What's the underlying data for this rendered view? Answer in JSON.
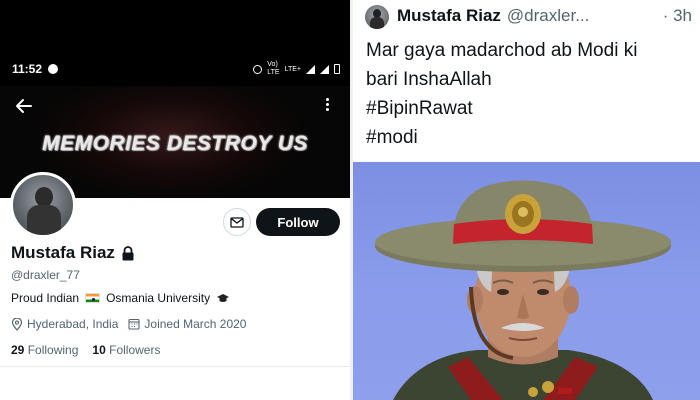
{
  "status_bar": {
    "time": "11:52",
    "network": "Vo) LTE",
    "network_lines": [
      "Vo)",
      "LTE"
    ],
    "lte": "LTE+"
  },
  "profile": {
    "banner_text": "MEMORIES DESTROY US",
    "name": "Mustafa Riaz",
    "handle": "@draxler_77",
    "bio_text": "Proud Indian",
    "bio_university": "Osmania University",
    "location": "Hyderabad, India",
    "joined": "Joined March 2020",
    "following_count": "29",
    "following_label": "Following",
    "followers_count": "10",
    "followers_label": "Followers",
    "follow_label": "Follow"
  },
  "tweet": {
    "name": "Mustafa Riaz",
    "handle": "@draxler...",
    "time": "· 3h",
    "lines": [
      "Mar gaya madarchod ab Modi ki",
      "bari InshaAllah",
      "#BipinRawat",
      "#modi"
    ]
  },
  "colors": {
    "follow_bg": "#0f1419",
    "muted_text": "#536471",
    "photo_background": "#8a9ce9",
    "flag": [
      "#ff9933",
      "#ffffff",
      "#138808"
    ]
  },
  "icons": [
    "back-arrow-icon",
    "more-options-icon",
    "mail-icon",
    "lock-icon",
    "india-flag-icon",
    "graduation-cap-icon",
    "location-pin-icon",
    "calendar-icon"
  ]
}
